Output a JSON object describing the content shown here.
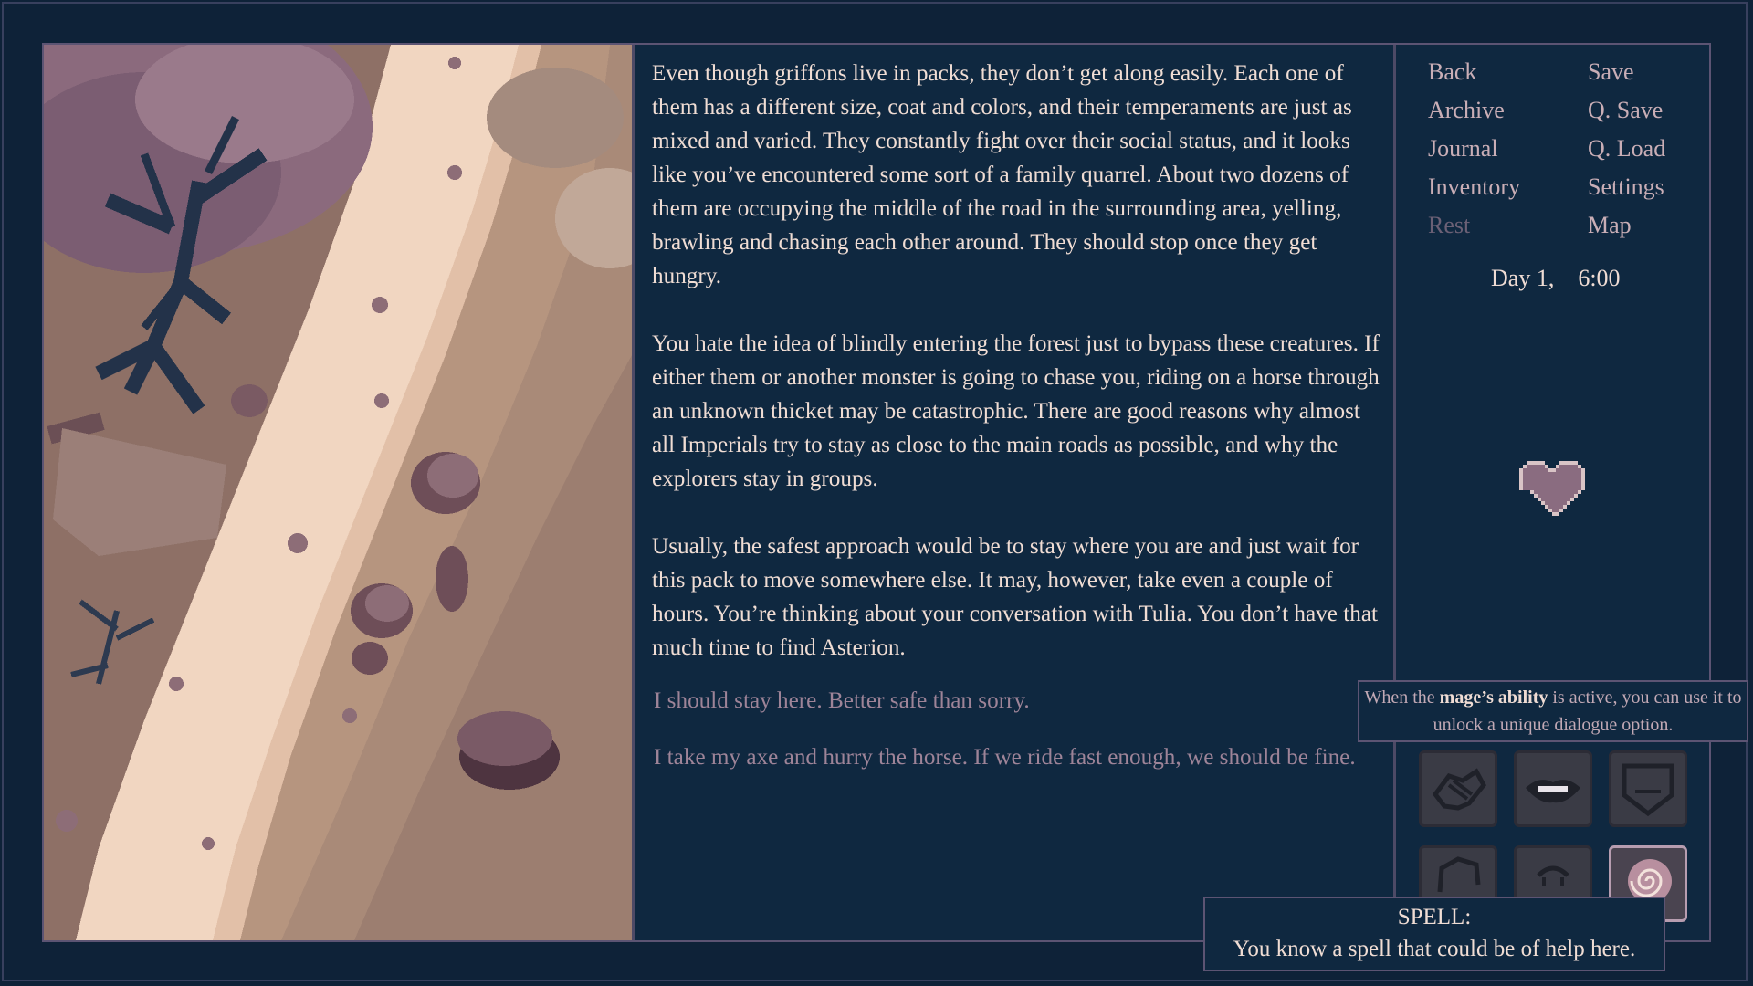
{
  "story": {
    "paragraphs": [
      "Even though griffons live in packs, they don’t get along easily. Each one of them has a different size, coat and colors, and their temperaments are just as mixed and varied. They constantly fight over their social status, and it looks like you’ve encountered some sort of a family quarrel. About two dozens of them are occupying the middle of the road in the surrounding area, yelling, brawling and chasing each other around. They should stop once they get hungry.",
      "You hate the idea of blindly entering the forest just to bypass these creatures. If either them or another monster is going to chase you, riding on a horse through an unknown thicket may be catastrophic. There are good reasons why almost all Imperials try to stay as close to the main roads as possible, and why the explorers stay in groups.",
      "Usually, the safest approach would be to stay where you are and just wait for this pack to move somewhere else. It may, however, take even a couple of hours. You’re thinking about your conversation with Tulia. You don’t have that much time to find Asterion."
    ],
    "choices": [
      "I should stay here. Better safe than sorry.",
      "I take my axe and hurry the horse. If we ride fast enough, we should be fine."
    ]
  },
  "menu": {
    "left": [
      "Back",
      "Archive",
      "Journal",
      "Inventory",
      "Rest"
    ],
    "right": [
      "Save",
      "Q. Save",
      "Q. Load",
      "Settings",
      "Map"
    ],
    "disabled": [
      "Rest"
    ]
  },
  "clock": {
    "day": "Day 1,",
    "time": "6:00"
  },
  "tooltip": {
    "before": "When the ",
    "bold": "mage’s ability",
    "after": " is active, you can use it to unlock a unique dialogue option."
  },
  "abilities": [
    "handshake-icon",
    "lips-icon",
    "mask-icon",
    "fist-icon",
    "face-icon",
    "spiral-spell-icon"
  ],
  "spell": {
    "title": "SPELL:",
    "text": "You know a spell that could be of help here."
  },
  "colors": {
    "background": "#0e2238",
    "panel": "#0f2840",
    "text": "#f0ddd4",
    "choice": "#9e8498",
    "heart": "#8a6c80"
  }
}
